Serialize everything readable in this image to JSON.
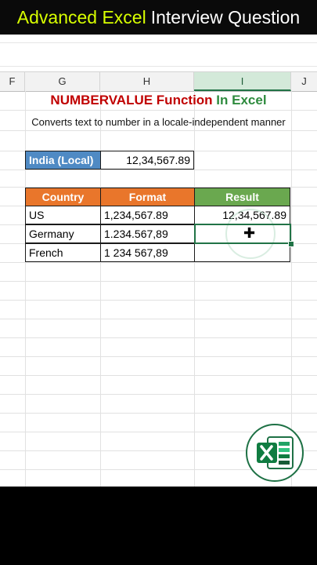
{
  "banner": {
    "part1": "Advanced Excel",
    "part2": "Interview Question"
  },
  "columns": [
    {
      "label": "F"
    },
    {
      "label": "G"
    },
    {
      "label": "H"
    },
    {
      "label": "I"
    },
    {
      "label": "J"
    }
  ],
  "sheet": {
    "title_part1": "NUMBERVALUE Function",
    "title_part2": "In Excel",
    "subtitle": "Converts text to number in a locale-independent manner",
    "india_label": "India (Local)",
    "india_value": "12,34,567.89",
    "table": {
      "headers": {
        "country": "Country",
        "format": "Format",
        "result": "Result"
      },
      "rows": [
        {
          "country": "US",
          "format": "1,234,567.89",
          "result": "12,34,567.89"
        },
        {
          "country": "Germany",
          "format": "1.234.567,89",
          "result": ""
        },
        {
          "country": "French",
          "format": "1 234 567,89",
          "result": ""
        }
      ]
    }
  },
  "colors": {
    "header_orange": "#e9762b",
    "header_green": "#6aa84f",
    "india_blue": "#4f8ac4",
    "title_red": "#c00000",
    "title_green": "#2e8b3e",
    "selection_green": "#217346"
  },
  "icons": {
    "logo": "excel-logo-icon",
    "cursor": "cell-select-cursor-icon"
  }
}
